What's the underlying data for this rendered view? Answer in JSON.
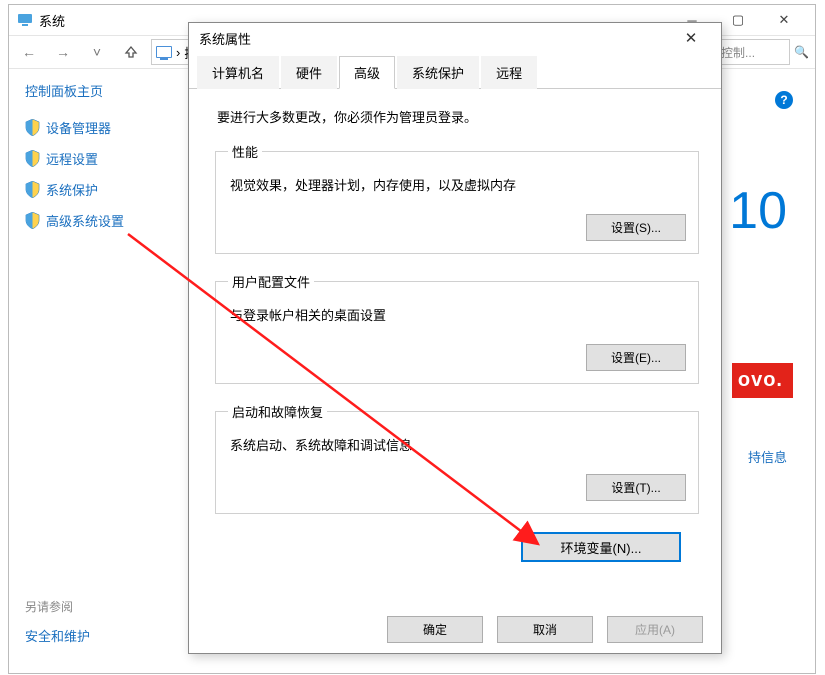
{
  "system_window": {
    "title": "系统",
    "nav": {
      "crumb": "控",
      "search_placeholder": "搜控制..."
    },
    "sidebar": {
      "home": "控制面板主页",
      "items": [
        {
          "label": "设备管理器"
        },
        {
          "label": "远程设置"
        },
        {
          "label": "系统保护"
        },
        {
          "label": "高级系统设置"
        }
      ],
      "see_also": "另请参阅",
      "security": "安全和维护"
    },
    "right": {
      "big_text": "10",
      "brand_fragment": "ovo.",
      "support": "持信息",
      "help": "?"
    }
  },
  "dialog": {
    "title": "系统属性",
    "tabs": [
      "计算机名",
      "硬件",
      "高级",
      "系统保护",
      "远程"
    ],
    "active_tab_index": 2,
    "intro": "要进行大多数更改，你必须作为管理员登录。",
    "groups": {
      "perf": {
        "legend": "性能",
        "desc": "视觉效果，处理器计划，内存使用，以及虚拟内存",
        "button": "设置(S)..."
      },
      "profile": {
        "legend": "用户配置文件",
        "desc": "与登录帐户相关的桌面设置",
        "button": "设置(E)..."
      },
      "startup": {
        "legend": "启动和故障恢复",
        "desc": "系统启动、系统故障和调试信息",
        "button": "设置(T)..."
      }
    },
    "env_button": "环境变量(N)...",
    "footer": {
      "ok": "确定",
      "cancel": "取消",
      "apply": "应用(A)"
    }
  }
}
